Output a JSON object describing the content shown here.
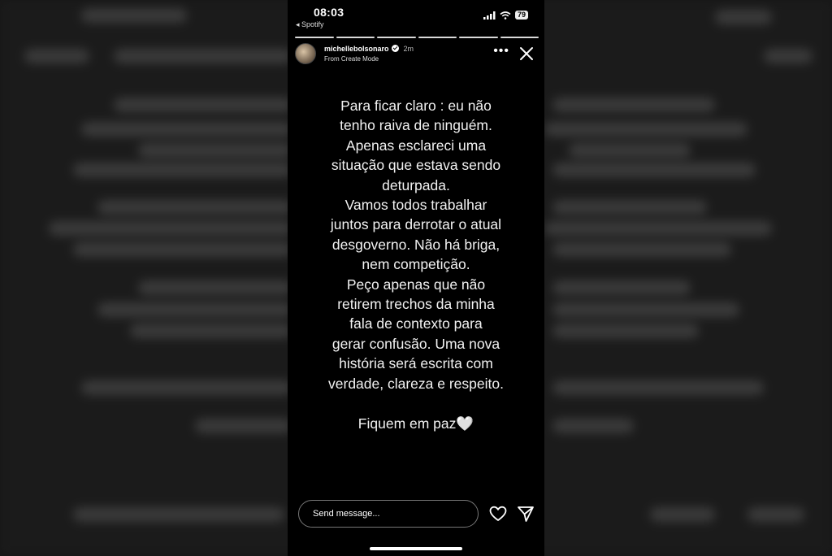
{
  "status_bar": {
    "time": "08:03",
    "back_app": "◂ Spotify",
    "battery": "79"
  },
  "story": {
    "progress_segments": 6,
    "username": "michellebolsonaro",
    "time_ago": "2m",
    "subtitle": "From Create Mode",
    "more_glyph": "•••",
    "body": "Para ficar claro : eu não\ntenho raiva de ninguém.\nApenas esclareci uma\nsituação que estava sendo\ndeturpada.\nVamos todos trabalhar\njuntos para derrotar o atual\ndesgoverno. Não há briga,\nnem competição.\nPeço apenas que não\nretirem trechos da minha\nfala de contexto para\ngerar confusão. Uma nova\nhistória será escrita com\nverdade, clareza e respeito.",
    "signoff": "Fiquem em paz",
    "signoff_emoji": "🤍"
  },
  "reply": {
    "placeholder": "Send message..."
  },
  "icons": {
    "avatar": "avatar",
    "verified": "verified-badge-icon",
    "more": "more-options-icon",
    "close": "close-icon",
    "heart": "heart-icon",
    "send": "send-icon"
  }
}
